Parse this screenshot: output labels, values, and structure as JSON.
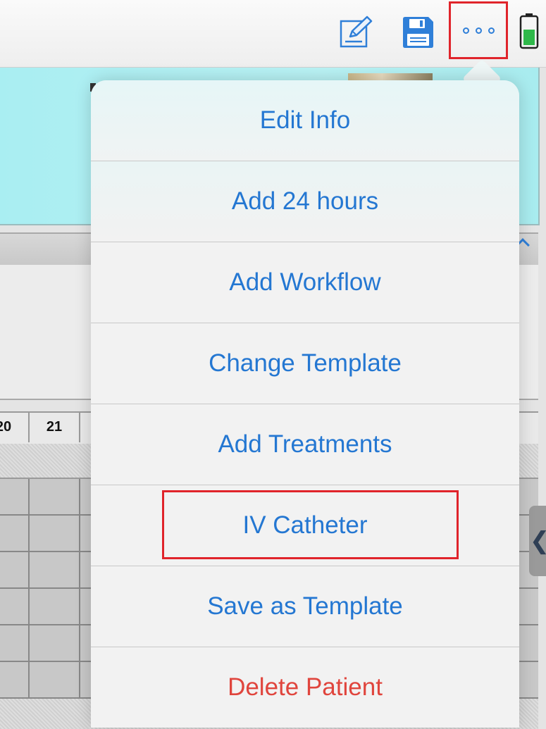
{
  "toolbar": {
    "edit_icon": "edit-note-icon",
    "save_icon": "floppy-disk-icon",
    "more_icon": "more-dots-icon",
    "battery_icon": "battery-icon",
    "accent_color": "#2f7fd8",
    "highlight_color": "#e0242b"
  },
  "grid": {
    "hours": [
      "20",
      "21"
    ]
  },
  "menu": {
    "items": [
      {
        "label": "Edit Info"
      },
      {
        "label": "Add 24 hours"
      },
      {
        "label": "Add Workflow"
      },
      {
        "label": "Change Template"
      },
      {
        "label": "Add Treatments"
      },
      {
        "label": "IV Catheter"
      },
      {
        "label": "Save as Template"
      },
      {
        "label": "Delete Patient"
      }
    ],
    "text_color": "#2477d2",
    "destructive_color": "#e0453d"
  },
  "side_tab": {
    "icon": "chevron-left-icon",
    "glyph": "❮"
  }
}
